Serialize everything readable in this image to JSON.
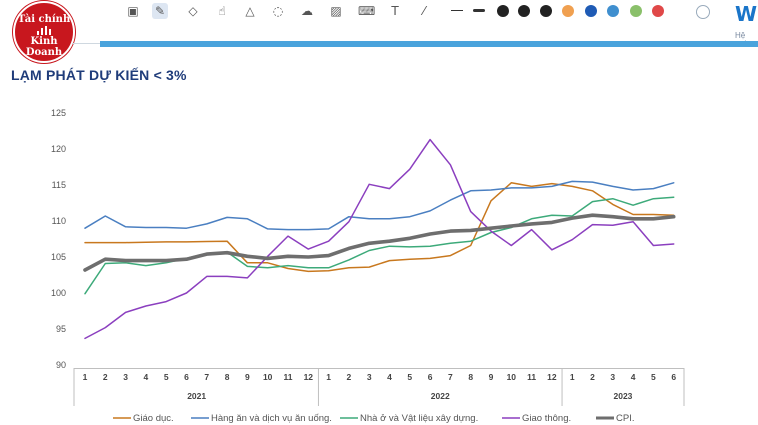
{
  "logo": {
    "line1": "Tài chính",
    "line2": "Kinh Doanh"
  },
  "brand": {
    "mark": "W",
    "subtitle": "Hệ thố"
  },
  "toolbar": {
    "icons": [
      "gallery-icon",
      "pen-icon",
      "eraser-icon",
      "pointer-icon",
      "shapes-icon",
      "lasso-icon",
      "cloud-icon",
      "image-icon",
      "keyboard-icon",
      "text-icon",
      "highlighter-icon"
    ],
    "colors": [
      "#222222",
      "#222222",
      "#222222",
      "#f0a050",
      "#1f5bb5",
      "#3f8fcf",
      "#8ac06a",
      "#e04848",
      "#ffffff"
    ]
  },
  "page_title": "LẠM PHÁT DỰ KIẾN < 3%",
  "chart_data": {
    "type": "line",
    "title": "",
    "xlabel": "",
    "ylabel": "",
    "ylim": [
      90,
      125
    ],
    "yticks": [
      90,
      95,
      100,
      105,
      110,
      115,
      120,
      125
    ],
    "categories": [
      "1",
      "2",
      "3",
      "4",
      "5",
      "6",
      "7",
      "8",
      "9",
      "10",
      "11",
      "12",
      "1",
      "2",
      "3",
      "4",
      "5",
      "6",
      "7",
      "8",
      "9",
      "10",
      "11",
      "12",
      "1",
      "2",
      "3",
      "4",
      "5",
      "6"
    ],
    "year_groups": [
      {
        "label": "2021",
        "start": 0,
        "end": 11
      },
      {
        "label": "2022",
        "start": 12,
        "end": 23
      },
      {
        "label": "2023",
        "start": 24,
        "end": 29
      }
    ],
    "grid": false,
    "legend_position": "bottom",
    "series": [
      {
        "name": "Giáo dục.",
        "color": "#c8781e",
        "width": 1.5,
        "values": [
          107,
          107,
          107,
          107.05,
          107.1,
          107.1,
          107.15,
          107.2,
          104.2,
          104.2,
          103.4,
          103,
          103.1,
          103.5,
          103.6,
          104.5,
          104.7,
          104.8,
          105.2,
          106.6,
          112.8,
          115.3,
          114.8,
          115.2,
          114.8,
          114.2,
          112.3,
          110.9,
          110.9,
          110.8
        ]
      },
      {
        "name": "Hàng ăn và dịch vụ ăn uống.",
        "color": "#4a7fc1",
        "width": 1.5,
        "values": [
          109,
          110.7,
          109.2,
          109.1,
          109.1,
          109,
          109.6,
          110.5,
          110.3,
          108.9,
          108.8,
          108.8,
          108.9,
          110.6,
          110.3,
          110.3,
          110.6,
          111.4,
          112.9,
          114.2,
          114.3,
          114.6,
          114.6,
          114.8,
          115.5,
          115.4,
          114.8,
          114.3,
          114.5,
          115.3
        ]
      },
      {
        "name": "Nhà ở và Vật liệu xây dựng.",
        "color": "#3daa7a",
        "width": 1.5,
        "values": [
          99.9,
          104.1,
          104.2,
          103.8,
          104.2,
          104.8,
          105.5,
          105.7,
          103.7,
          103.5,
          103.8,
          103.5,
          103.5,
          104.6,
          105.9,
          106.5,
          106.4,
          106.5,
          106.9,
          107.2,
          108.4,
          109.1,
          110.3,
          110.8,
          110.7,
          112.7,
          113.1,
          112.2,
          113.1,
          113.3
        ]
      },
      {
        "name": "Giao thông.",
        "color": "#8b3fbf",
        "width": 1.5,
        "values": [
          93.7,
          95.2,
          97.3,
          98.2,
          98.8,
          100,
          102.3,
          102.3,
          102.1,
          105.1,
          107.9,
          106.1,
          107.2,
          109.9,
          115.1,
          114.5,
          117.2,
          121.3,
          117.8,
          111.3,
          108.6,
          106.6,
          108.8,
          106,
          107.4,
          109.5,
          109.4,
          109.9,
          106.6,
          106.8
        ]
      },
      {
        "name": "CPI.",
        "color": "#6e6e6e",
        "width": 3.6,
        "values": [
          103.2,
          104.7,
          104.5,
          104.5,
          104.5,
          104.7,
          105.4,
          105.6,
          105.1,
          104.8,
          105.1,
          105,
          105.2,
          106.2,
          106.9,
          107.2,
          107.6,
          108.2,
          108.6,
          108.7,
          109,
          109.3,
          109.6,
          109.8,
          110.4,
          110.8,
          110.6,
          110.3,
          110.3,
          110.6
        ]
      }
    ]
  }
}
